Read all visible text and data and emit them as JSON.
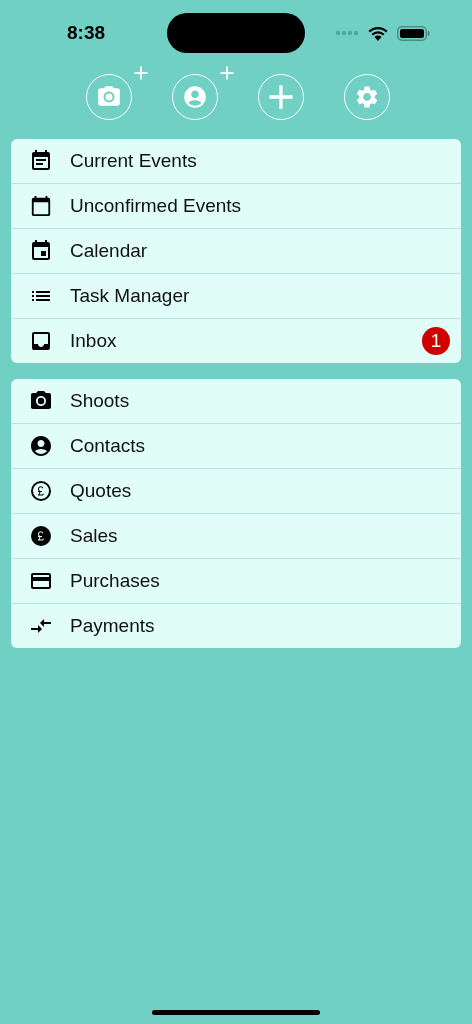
{
  "status_bar": {
    "time": "8:38"
  },
  "sections": [
    {
      "items": [
        {
          "label": "Current Events"
        },
        {
          "label": "Unconfirmed Events"
        },
        {
          "label": "Calendar"
        },
        {
          "label": "Task Manager"
        },
        {
          "label": "Inbox",
          "badge": "1"
        }
      ]
    },
    {
      "items": [
        {
          "label": "Shoots"
        },
        {
          "label": "Contacts"
        },
        {
          "label": "Quotes"
        },
        {
          "label": "Sales"
        },
        {
          "label": "Purchases"
        },
        {
          "label": "Payments"
        }
      ]
    }
  ]
}
